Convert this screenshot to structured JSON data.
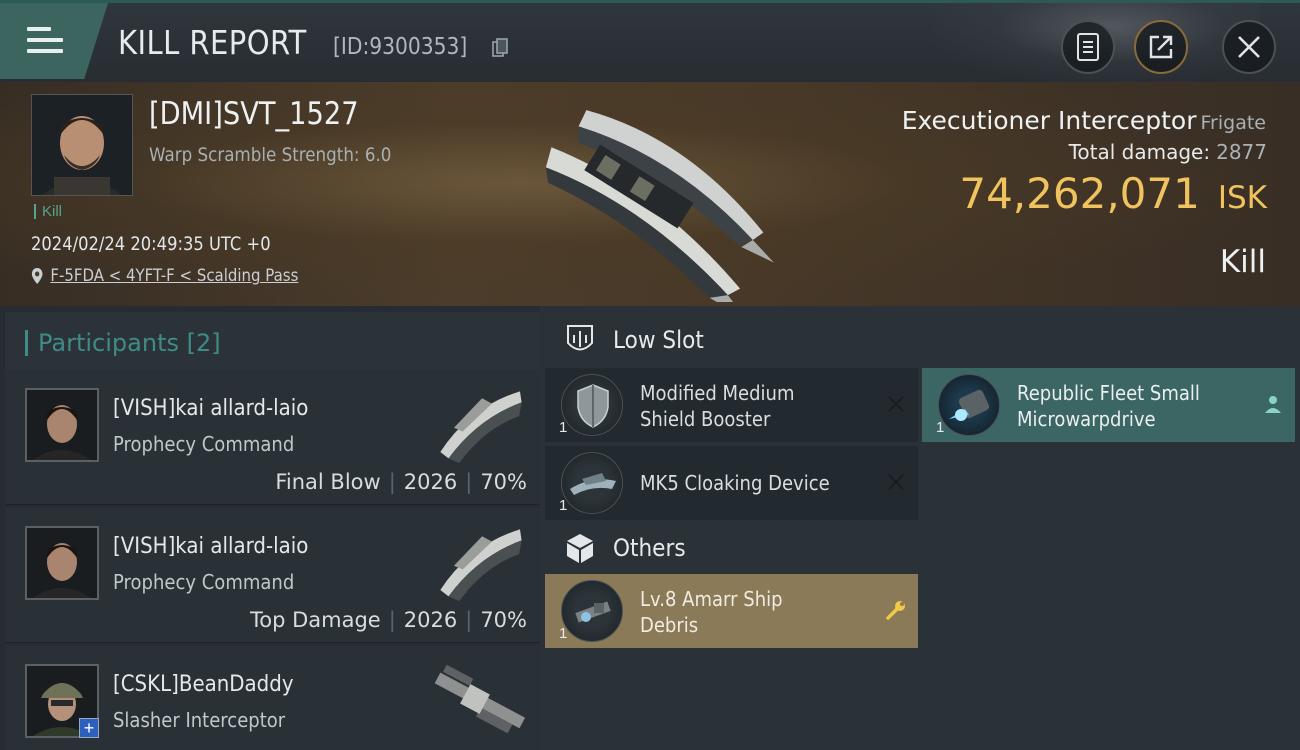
{
  "header": {
    "title": "KILL REPORT",
    "report_id": "[ID:9300353]",
    "icons": [
      "menu-icon",
      "copy-icon",
      "clipboard-icon",
      "share-icon",
      "close-icon"
    ]
  },
  "victim": {
    "name": "[DMI]SVT_1527",
    "warp_scramble": "Warp Scramble Strength: 6.0",
    "kill_tag": "Kill",
    "datetime": "2024/02/24 20:49:35 UTC +0",
    "location": "F-5FDA < 4YFT-F < Scalding Pass",
    "ship_name": "Executioner Interceptor",
    "ship_class": "Frigate",
    "total_damage_label": "Total damage:",
    "total_damage": "2877",
    "isk_value": "74,262,071",
    "isk_unit": "ISK",
    "outcome": "Kill"
  },
  "participants": {
    "title": "Participants",
    "count": "[2]",
    "items": [
      {
        "name": "[VISH]kai allard-laio",
        "ship": "Prophecy Command",
        "role": "Final Blow",
        "damage": "2026",
        "percent": "70%"
      },
      {
        "name": "[VISH]kai allard-laio",
        "ship": "Prophecy Command",
        "role": "Top Damage",
        "damage": "2026",
        "percent": "70%"
      },
      {
        "name": "[CSKL]BeanDaddy",
        "ship": "Slasher Interceptor",
        "role": "",
        "damage": "",
        "percent": ""
      }
    ]
  },
  "slots": {
    "low_slot_label": "Low Slot",
    "others_label": "Others",
    "low": [
      {
        "line1": "Modified Medium",
        "line2": "Shield Booster",
        "qty": "1",
        "state": "destroyed"
      },
      {
        "line1": "Republic Fleet Small",
        "line2": "Microwarpdrive",
        "qty": "1",
        "state": "dropped"
      },
      {
        "line1": "MK5 Cloaking Device",
        "line2": "",
        "qty": "1",
        "state": "destroyed"
      }
    ],
    "others": [
      {
        "line1": "Lv.8 Amarr Ship",
        "line2": "Debris",
        "qty": "1",
        "state": "salvage"
      }
    ]
  },
  "colors": {
    "accent_teal": "#3f8b86",
    "isk_gold": "#f0c35e",
    "dropped_bg": "#3c6664",
    "salvage_bg": "#8a7a57"
  }
}
